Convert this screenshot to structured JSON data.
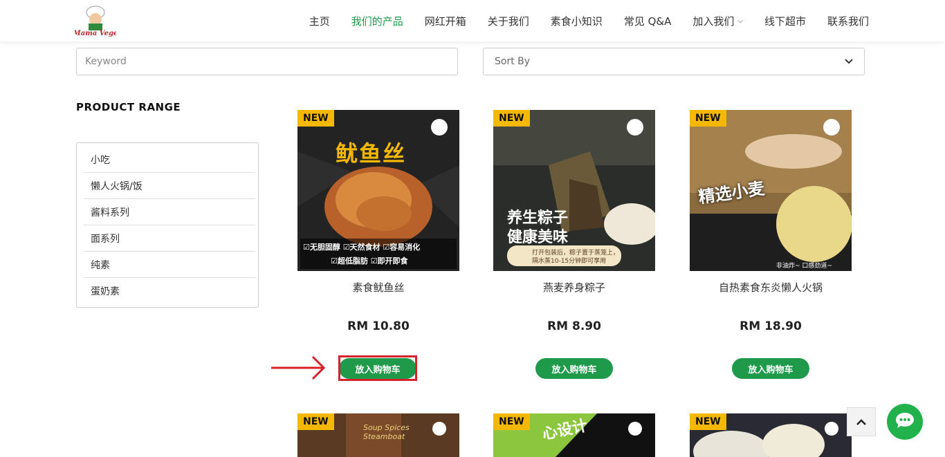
{
  "header": {
    "logo_text": "Mama Vege",
    "nav": [
      {
        "label": "主页"
      },
      {
        "label": "我们的产品"
      },
      {
        "label": "网红开箱"
      },
      {
        "label": "关于我们"
      },
      {
        "label": "素食小知识"
      },
      {
        "label": "常见 Q&A"
      },
      {
        "label": "加入我们"
      },
      {
        "label": "线下超市"
      },
      {
        "label": "联系我们"
      }
    ]
  },
  "filters": {
    "keyword_placeholder": "Keyword",
    "sort_placeholder": "Sort By"
  },
  "sidebar": {
    "title": "PRODUCT RANGE",
    "items": [
      {
        "label": "小吃"
      },
      {
        "label": "懒人火锅/饭"
      },
      {
        "label": "酱料系列"
      },
      {
        "label": "面系列"
      },
      {
        "label": "纯素"
      },
      {
        "label": "蛋奶素"
      }
    ]
  },
  "badge_new": "NEW",
  "products": [
    {
      "name": "素食鱿鱼丝",
      "price": "RM 10.80",
      "cart_label": "放入购物车",
      "img_text": "鱿鱼丝",
      "img_sub1": "☑无胆固醇 ☑天然食材 ☑容易消化",
      "img_sub2": "☑超低脂肪 ☑即开即食"
    },
    {
      "name": "燕麦养身粽子",
      "price": "RM 8.90",
      "cart_label": "放入购物车",
      "img_text": "养生粽子",
      "img_text2": "健康美味",
      "img_sub1": "打开包装后，粽子置于蒸笼上，",
      "img_sub2": "隔水蒸10-15分钟即可享用"
    },
    {
      "name": "自热素食东炎懒人火锅",
      "price": "RM 18.90",
      "cart_label": "放入购物车",
      "img_text": "精选小麦",
      "img_sub1": "非油炸~ 口感劲道~"
    }
  ],
  "row2": [
    {
      "img_text": "Soup Spices Steamboat"
    },
    {
      "img_text": "心设计"
    },
    {
      "img_text": ""
    }
  ],
  "colors": {
    "accent_green": "#1f9a4a",
    "badge_yellow": "#f5b800",
    "annotation_red": "#d8222a",
    "chat_green": "#22b24c"
  }
}
